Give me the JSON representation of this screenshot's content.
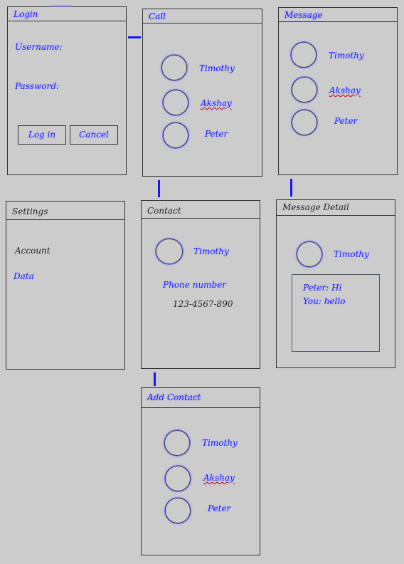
{
  "login": {
    "title": "Login",
    "username_label": "Username:",
    "password_label": "Password:",
    "login_button": "Log in",
    "cancel_button": "Cancel"
  },
  "call": {
    "title": "Call",
    "contacts": [
      "Timothy",
      "Akshay",
      "Peter"
    ]
  },
  "message": {
    "title": "Message",
    "contacts": [
      "Timothy",
      "Akshay",
      "Peter"
    ]
  },
  "settings": {
    "title": "Settings",
    "items": [
      "Account",
      "Data"
    ]
  },
  "contact": {
    "title": "Contact",
    "name": "Timothy",
    "phone_label": "Phone number",
    "phone_value": "123-4567-890"
  },
  "message_detail": {
    "title": "Message Detail",
    "name": "Timothy",
    "line1": "Peter: Hi",
    "line2": "You: hello"
  },
  "add_contact": {
    "title": "Add Contact",
    "contacts": [
      "Timothy",
      "Akshay",
      "Peter"
    ]
  }
}
